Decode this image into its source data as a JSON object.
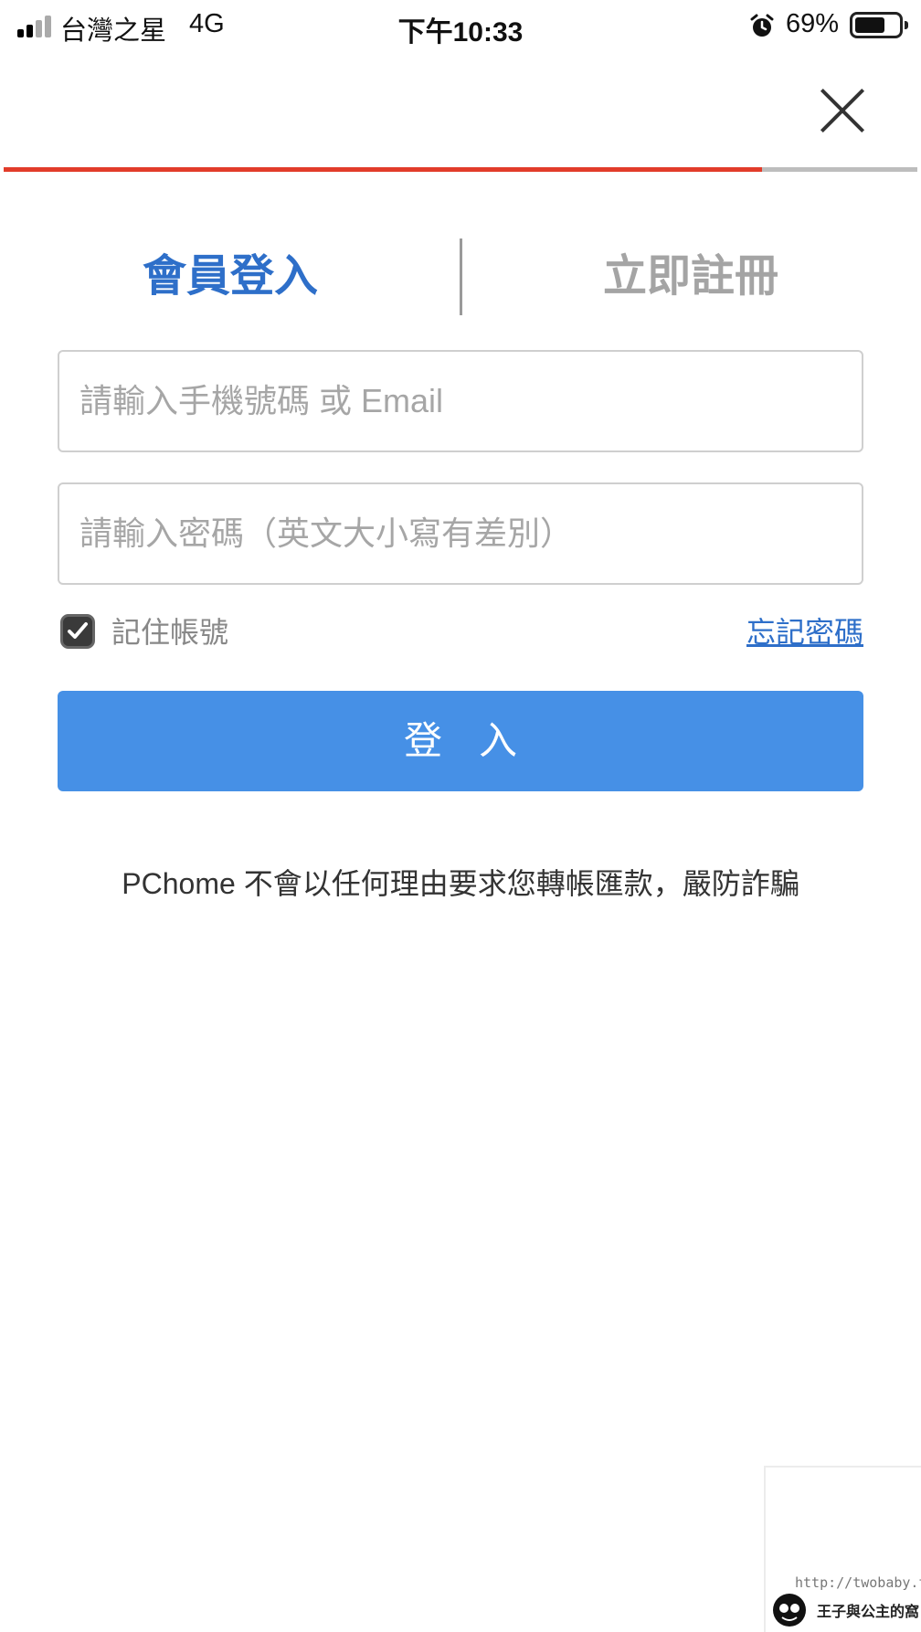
{
  "status_bar": {
    "carrier": "台灣之星",
    "network": "4G",
    "time": "下午10:33",
    "battery_percent": "69%",
    "battery_level": 0.69,
    "signal_bars": 2
  },
  "progress": {
    "fraction": 0.83,
    "fill_color": "#e23c2a",
    "track_color": "#bdbdbd"
  },
  "tabs": {
    "login": "會員登入",
    "register": "立即註冊",
    "active": "login"
  },
  "form": {
    "account_placeholder": "請輸入手機號碼 或 Email",
    "account_value": "",
    "password_placeholder": "請輸入密碼（英文大小寫有差別）",
    "password_value": "",
    "remember_label": "記住帳號",
    "remember_checked": true,
    "forgot_link": "忘記密碼",
    "submit_label": "登入"
  },
  "notice": "PChome 不會以任何理由要求您轉帳匯款，嚴防詐騙",
  "watermark": {
    "url": "http://twobaby.tw/",
    "text": "王子與公主的窩"
  },
  "colors": {
    "accent": "#2e6fc9",
    "button": "#4690e6",
    "inactive_tab": "#a4a4a4"
  },
  "icons": {
    "close": "close-icon",
    "alarm": "alarm-clock-icon",
    "battery": "battery-icon",
    "signal": "signal-bars-icon",
    "checkbox": "checkmark-icon"
  }
}
